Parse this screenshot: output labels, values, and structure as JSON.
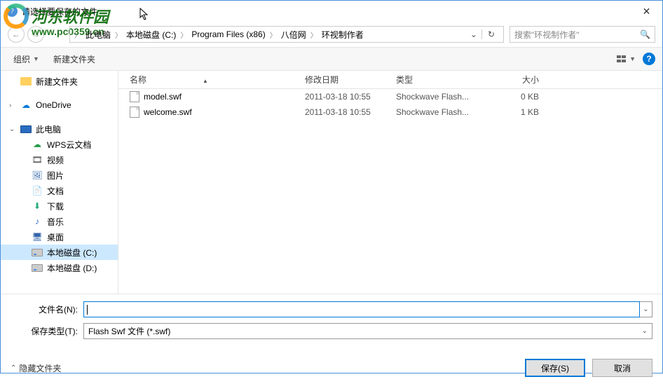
{
  "window": {
    "title": "请选择要保存的文件"
  },
  "watermark": {
    "text": "河东软件园",
    "url": "www.pc0359.cn"
  },
  "breadcrumb": {
    "items": [
      "此电脑",
      "本地磁盘 (C:)",
      "Program Files (x86)",
      "八倍网",
      "环视制作者"
    ]
  },
  "search": {
    "placeholder": "搜索\"环视制作者\""
  },
  "toolbar": {
    "organize": "组织",
    "newfolder": "新建文件夹"
  },
  "columns": {
    "name": "名称",
    "date": "修改日期",
    "type": "类型",
    "size": "大小"
  },
  "sidebar": {
    "items": [
      {
        "label": "新建文件夹",
        "icon": "folder",
        "level": 1
      },
      {
        "label": "OneDrive",
        "icon": "onedrive",
        "level": 1,
        "expandable": true,
        "spacer_before": true
      },
      {
        "label": "此电脑",
        "icon": "pc",
        "level": 1,
        "expandable": true,
        "expanded": true,
        "spacer_before": true
      },
      {
        "label": "WPS云文档",
        "icon": "wps",
        "level": 2
      },
      {
        "label": "视频",
        "icon": "video",
        "level": 2
      },
      {
        "label": "图片",
        "icon": "pictures",
        "level": 2
      },
      {
        "label": "文档",
        "icon": "docs",
        "level": 2
      },
      {
        "label": "下载",
        "icon": "download",
        "level": 2
      },
      {
        "label": "音乐",
        "icon": "music",
        "level": 2
      },
      {
        "label": "桌面",
        "icon": "desktop",
        "level": 2
      },
      {
        "label": "本地磁盘 (C:)",
        "icon": "disk",
        "level": 2,
        "selected": true
      },
      {
        "label": "本地磁盘 (D:)",
        "icon": "disk",
        "level": 2
      }
    ]
  },
  "files": [
    {
      "name": "model.swf",
      "date": "2011-03-18 10:55",
      "type": "Shockwave Flash...",
      "size": "0 KB"
    },
    {
      "name": "welcome.swf",
      "date": "2011-03-18 10:55",
      "type": "Shockwave Flash...",
      "size": "1 KB"
    }
  ],
  "form": {
    "filename_label": "文件名(N):",
    "filename_value": "",
    "filetype_label": "保存类型(T):",
    "filetype_value": "Flash Swf 文件 (*.swf)"
  },
  "footer": {
    "hide_folders": "隐藏文件夹",
    "save": "保存(S)",
    "cancel": "取消"
  }
}
